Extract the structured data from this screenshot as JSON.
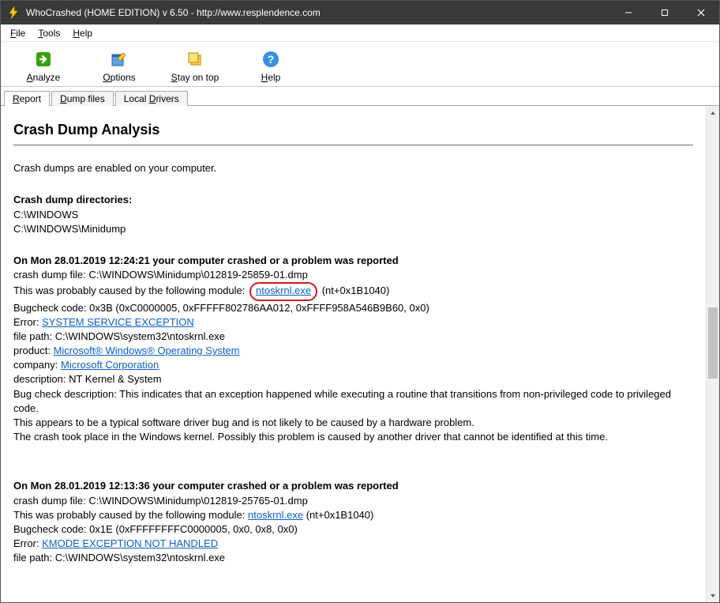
{
  "titlebar": {
    "title": "WhoCrashed  (HOME EDITION)  v 6.50   -   http://www.resplendence.com"
  },
  "menubar": {
    "file": "File",
    "tools": "Tools",
    "help": "Help"
  },
  "toolbar": {
    "analyze": "Analyze",
    "options": "Options",
    "stayontop": "Stay on top",
    "help": "Help"
  },
  "tabs": {
    "report": "Report",
    "dumpfiles": "Dump files",
    "localdrivers": "Local Drivers"
  },
  "report": {
    "heading": "Crash Dump Analysis",
    "enabled_line": "Crash dumps are enabled on your computer.",
    "dirs_label": "Crash dump directories:",
    "dir1": "C:\\WINDOWS",
    "dir2": "C:\\WINDOWS\\Minidump",
    "crash1": {
      "headline": "On Mon 28.01.2019 12:24:21 your computer crashed or a problem was reported",
      "dumpfile": "crash dump file: C:\\WINDOWS\\Minidump\\012819-25859-01.dmp",
      "cause_prefix": "This was probably caused by the following module: ",
      "cause_link": "ntoskrnl.exe",
      "cause_suffix": " (nt+0x1B1040)",
      "bugcheck": "Bugcheck code: 0x3B (0xC0000005, 0xFFFFF802786AA012, 0xFFFF958A546B9B60, 0x0)",
      "error_label": "Error: ",
      "error_link": "SYSTEM SERVICE EXCEPTION",
      "filepath": "file path: C:\\WINDOWS\\system32\\ntoskrnl.exe",
      "product_label": "product: ",
      "product_link": "Microsoft® Windows® Operating System",
      "company_label": "company: ",
      "company_link": "Microsoft Corporation",
      "description": "description: NT Kernel & System",
      "bugcheck_desc": "Bug check description: This indicates that an exception happened while executing a routine that transitions from non-privileged code to privileged code.",
      "appears": "This appears to be a typical software driver bug and is not likely to be caused by a hardware problem.",
      "kernel_note": "The crash took place in the Windows kernel. Possibly this problem is caused by another driver that cannot be identified at this time."
    },
    "crash2": {
      "headline": "On Mon 28.01.2019 12:13:36 your computer crashed or a problem was reported",
      "dumpfile": "crash dump file: C:\\WINDOWS\\Minidump\\012819-25765-01.dmp",
      "cause_prefix": "This was probably caused by the following module: ",
      "cause_link": "ntoskrnl.exe",
      "cause_suffix": " (nt+0x1B1040)",
      "bugcheck": "Bugcheck code: 0x1E (0xFFFFFFFFC0000005, 0x0, 0x8, 0x0)",
      "error_label": "Error: ",
      "error_link": "KMODE EXCEPTION NOT HANDLED",
      "filepath": "file path: C:\\WINDOWS\\system32\\ntoskrnl.exe"
    }
  }
}
